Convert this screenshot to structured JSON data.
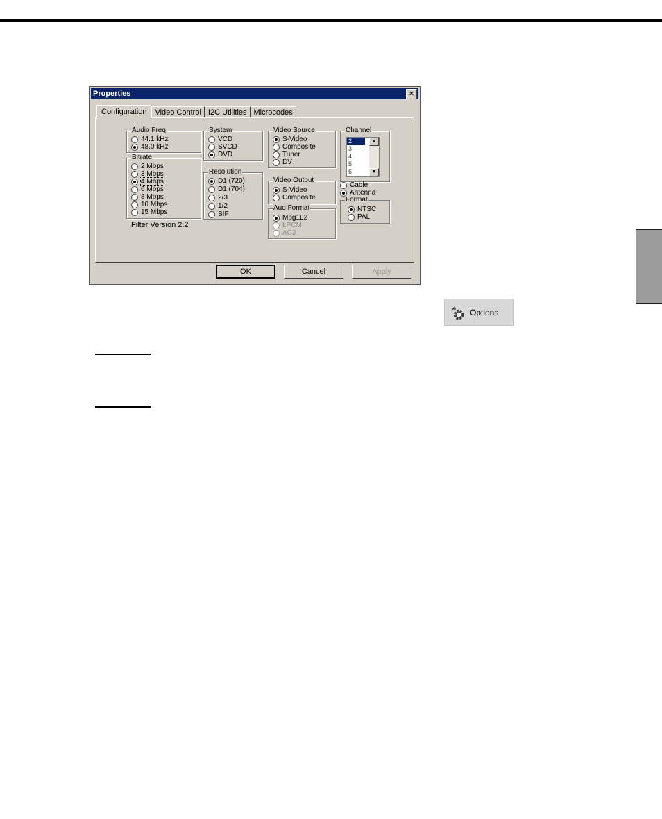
{
  "dialog": {
    "title": "Properties",
    "close_label": "×",
    "tabs": [
      "Configuration",
      "Video Control",
      "I2C Utilities",
      "Microcodes"
    ],
    "audio_freq": {
      "title": "Audio Freq",
      "options": [
        "44.1 kHz",
        "48.0 kHz"
      ],
      "selected": "48.0 kHz"
    },
    "bitrate": {
      "title": "Bitrate",
      "options": [
        "2 Mbps",
        "3 Mbps",
        "4 Mbps",
        "6 Mbps",
        "8 Mbps",
        "10 Mbps",
        "15 Mbps"
      ],
      "selected": "4 Mbps"
    },
    "system": {
      "title": "System",
      "options": [
        "VCD",
        "SVCD",
        "DVD"
      ],
      "selected": "DVD"
    },
    "resolution": {
      "title": "Resolution",
      "options": [
        "D1 (720)",
        "D1 (704)",
        "2/3",
        "1/2",
        "SIF"
      ],
      "selected": "D1 (720)"
    },
    "video_source": {
      "title": "Video Source",
      "options": [
        "S-Video",
        "Composite",
        "Tuner",
        "DV"
      ],
      "selected": "S-Video"
    },
    "video_output": {
      "title": "Video Output",
      "options": [
        "S-Video",
        "Composite"
      ],
      "selected": "S-Video"
    },
    "audio_format": {
      "title": "Aud Format",
      "options": [
        "Mpg1L2",
        "LPCM",
        "AC3"
      ],
      "selected": "Mpg1L2"
    },
    "channel": {
      "title": "Channel",
      "items": [
        "2",
        "3",
        "4",
        "5",
        "6"
      ],
      "selected": "2"
    },
    "tuner_input": {
      "options": [
        "Cable",
        "Antenna"
      ],
      "selected": "Antenna"
    },
    "format": {
      "title": "Format",
      "options": [
        "NTSC",
        "PAL"
      ],
      "selected": "NTSC"
    },
    "filter_version": "Filter Version 2.2",
    "buttons": {
      "ok": "OK",
      "cancel": "Cancel",
      "apply": "Apply"
    }
  },
  "options_button": {
    "label": "Options",
    "icon": "gear-icon"
  }
}
